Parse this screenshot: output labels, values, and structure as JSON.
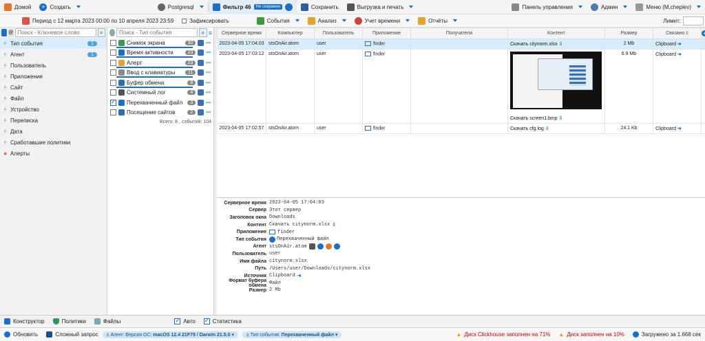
{
  "topbar": {
    "home": "Домой",
    "create": "Создать",
    "db": "Postgresql",
    "filter_tab": "Фильтр 46",
    "not_saved": "Не сохранен",
    "save": "Сохранить",
    "export": "Выгрузка и печать",
    "control_panel": "Панель управления",
    "admin": "Админ",
    "menu": "Меню (M.cheplev)"
  },
  "secbar": {
    "period": "Период с 12 марта 2023 00:00 по 10 апреля 2023 23:59",
    "fixed": "Зафиксировать",
    "events": "События",
    "analysis": "Анализ",
    "time_acc": "Учет времени",
    "reports": "Отчёты",
    "limit_label": "Лимит:"
  },
  "left": {
    "search_placeholder": "Поиск - Ключевое слово",
    "items": [
      {
        "label": "Тип события",
        "badge": "1"
      },
      {
        "label": "Агент",
        "badge": "1"
      },
      {
        "label": "Пользователь"
      },
      {
        "label": "Приложение"
      },
      {
        "label": "Сайт"
      },
      {
        "label": "Файл"
      },
      {
        "label": "Устройство"
      },
      {
        "label": "Переписка"
      },
      {
        "label": "Дата"
      },
      {
        "label": "Сработавшие политики"
      },
      {
        "label": "Алерты"
      }
    ]
  },
  "mid": {
    "search_placeholder": "Поиск - Тип события",
    "items": [
      {
        "label": "Снимок экрана",
        "count": "30"
      },
      {
        "label": "Время активности",
        "count": "23"
      },
      {
        "label": "Алерт",
        "count": "23"
      },
      {
        "label": "Ввод с клавиатуры",
        "count": "11"
      },
      {
        "label": "Буфер обмена",
        "count": "8"
      },
      {
        "label": "Системный лог",
        "count": "4"
      },
      {
        "label": "Перехваченный файл",
        "count": "3"
      },
      {
        "label": "Посещение сайтов",
        "count": "2"
      }
    ],
    "total": "Всего: 8 , событий: 104"
  },
  "table": {
    "headers": [
      "Серверное время",
      "Компьютер",
      "Пользователь",
      "Приложение",
      "Получатели",
      "Контент",
      "Размер",
      "Связано с"
    ],
    "rows": [
      {
        "time": "2023-04-05 17:04:03",
        "computer": "stsOnAir.atom",
        "user": "user",
        "app": "finder",
        "content": "Скачать citynorm.xlsx",
        "size": "2 Mb",
        "linked": "Clipboard"
      },
      {
        "time": "2023-04-05 17:03:12",
        "computer": "stsOnAir.atom",
        "user": "user",
        "app": "finder",
        "content": "Скачать screen1.bmp",
        "size": "6.9 Mb",
        "linked": "Clipboard"
      },
      {
        "time": "2023-04-05 17:02:57",
        "computer": "stsOnAir.atom",
        "user": "user",
        "app": "finder",
        "content": "Скачать cfg.log",
        "size": "24.1 Kb",
        "linked": "Clipboard"
      }
    ]
  },
  "detail": [
    {
      "k": "Серверное время",
      "v": "2023-04-05 17:04:03"
    },
    {
      "k": "Сервер",
      "v": "Этот сервер"
    },
    {
      "k": "Заголовок окна",
      "v": "Downloads"
    },
    {
      "k": "Контент",
      "v": "Скачать citynorm.xlsx"
    },
    {
      "k": "Приложение",
      "v": "finder"
    },
    {
      "k": "Тип события",
      "v": "Перехваченный файл"
    },
    {
      "k": "Агент",
      "v": "stsOnAir.atom"
    },
    {
      "k": "Пользователь",
      "v": "user"
    },
    {
      "k": "Имя файла",
      "v": "citynorm.xlsx"
    },
    {
      "k": "Путь",
      "v": "/Users/user/Downloads/citynorm.xlsx"
    },
    {
      "k": "Источник",
      "v": "Clipboard"
    },
    {
      "k": "Формат буфера обмена",
      "v": "Файл"
    },
    {
      "k": "Размер",
      "v": "2 Mb"
    }
  ],
  "bottom1": {
    "constructor": "Конструктор",
    "policies": "Политики",
    "files": "Файлы",
    "auto": "Авто",
    "stats": "Статистика"
  },
  "bottom2": {
    "refresh": "Обновить",
    "complex": "Сложный запрос",
    "chip_agent_prefix": "± Агент: Версия ОС:",
    "chip_agent_value": "macOS 12.4 21F79 / Darwin 21.5.0",
    "chip_type_prefix": "± Тип события:",
    "chip_type_value": "Перехваченный файл",
    "warn1": "Диск Clickhouse заполнен на 71%",
    "warn2": "Диск заполнен на 10%",
    "loaded": "Загружено за 1.668 сек"
  }
}
